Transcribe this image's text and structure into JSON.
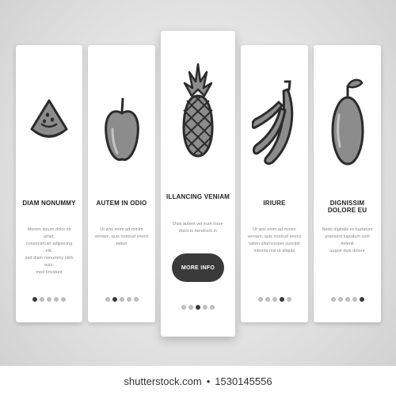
{
  "cards": [
    {
      "title": "DIAM NONUMMY",
      "body": [
        "Morem ipsum dolor sit amet,",
        "consectetuer adipiscing elit,",
        "sed diam nonummy nibh euis-",
        "mod tincidunt"
      ],
      "illustration": "watermelon-slice",
      "active_dot": 0
    },
    {
      "title": "AUTEM IN ODIO",
      "body": [
        "Ut wisi enim ad minim",
        "veniam, quis nostrud exerci",
        "tation"
      ],
      "illustration": "apple",
      "active_dot": 1
    },
    {
      "title": "ILLANCING VENIAM",
      "body": [
        "Duis autem vel eum iriure",
        "dolor in hendrerit in"
      ],
      "illustration": "pineapple",
      "active_dot": 2,
      "cta_label": "MORE INFO"
    },
    {
      "title": "IRIURE",
      "body": [
        "Ut wisi enim ad minim",
        "veniam, quis nostrud exerci",
        "tation ullamcorper suscipit",
        "lobortis nisl ut aliquip"
      ],
      "illustration": "bananas",
      "active_dot": 3
    },
    {
      "title": "DIGNISSIM DOLORE EU",
      "body": [
        "Nodo digitalis ex luptatum",
        "praesent luptatum zzril delenit",
        "augue duis dolore"
      ],
      "illustration": "orange",
      "active_dot": 4
    }
  ],
  "footer": {
    "site": "shutterstock.com",
    "separator": "•",
    "image_number": "1530145556"
  },
  "colors": {
    "icon_fill": "#8c8c8c",
    "icon_stroke": "#2b2b2b",
    "active_dot": "#3a3a3a",
    "inactive_dot": "#bdbdbd",
    "cta_background": "#3a3a3a"
  }
}
